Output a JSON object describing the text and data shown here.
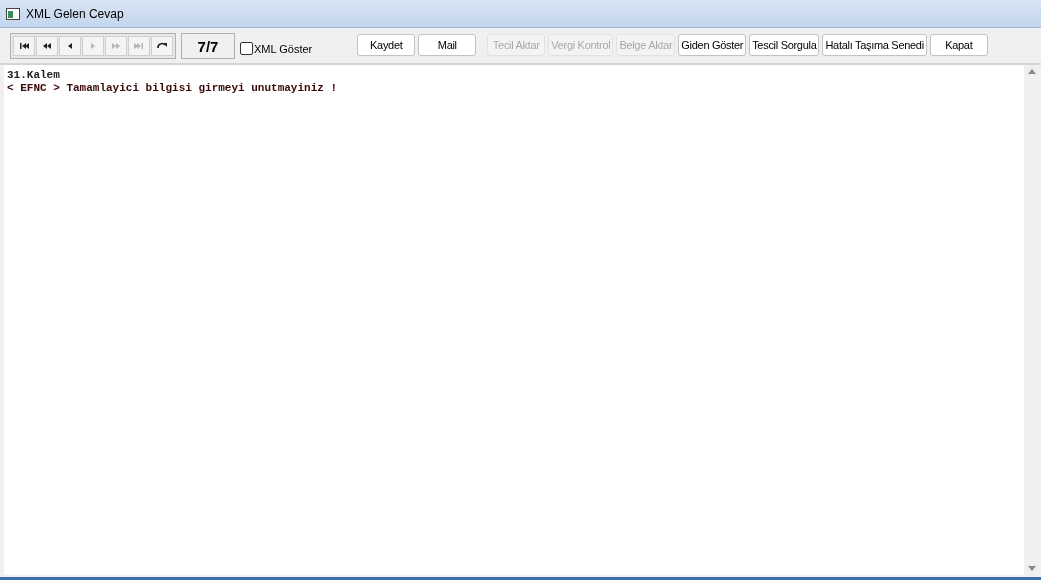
{
  "window": {
    "title": "XML Gelen Cevap"
  },
  "navigator": {
    "buttons": [
      {
        "kind": "first",
        "disabled": false
      },
      {
        "kind": "prior-page",
        "disabled": false
      },
      {
        "kind": "prior",
        "disabled": false
      },
      {
        "kind": "next",
        "disabled": true
      },
      {
        "kind": "next-page",
        "disabled": true
      },
      {
        "kind": "last",
        "disabled": true
      },
      {
        "kind": "refresh",
        "disabled": false
      }
    ],
    "counter": "7/7"
  },
  "xml_checkbox": {
    "label": "XML Göster",
    "checked": false
  },
  "buttons": [
    {
      "label": "Kaydet",
      "disabled": false
    },
    {
      "label": "Mail",
      "disabled": false
    },
    {
      "label": "Tecil Aktar",
      "disabled": true
    },
    {
      "label": "Vergi Kontrol",
      "disabled": true
    },
    {
      "label": "Belge Aktar",
      "disabled": true
    },
    {
      "label": "Giden Göster",
      "disabled": false
    },
    {
      "label": "Tescil Sorgula",
      "disabled": false
    },
    {
      "label": "Hatalı Taşıma Senedi",
      "disabled": false
    },
    {
      "label": "Kapat",
      "disabled": false
    }
  ],
  "response_lines": [
    "31.Kalem",
    "< EFNC > Tamamlayici bilgisi girmeyi unutmayiniz !"
  ]
}
